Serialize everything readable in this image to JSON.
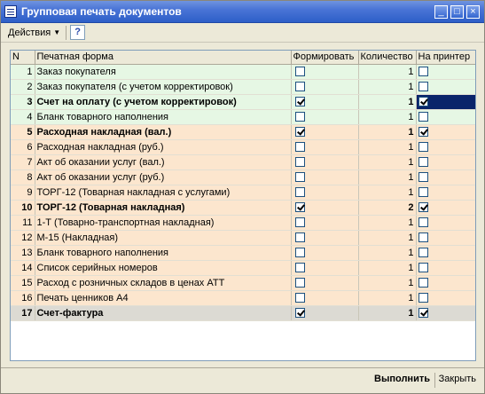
{
  "window": {
    "title": "Групповая печать документов"
  },
  "toolbar": {
    "actions_label": "Действия",
    "help_label": "?"
  },
  "titlebar_buttons": {
    "minimize": "_",
    "maximize": "□",
    "close": "×"
  },
  "table": {
    "columns": [
      "N",
      "Печатная форма",
      "Формировать",
      "Количество",
      "На принтер"
    ],
    "rows": [
      {
        "n": "1",
        "name": "Заказ покупателя",
        "form": false,
        "qty": "1",
        "printer": false,
        "style": "green",
        "bold": false
      },
      {
        "n": "2",
        "name": "Заказ покупателя (с учетом корректировок)",
        "form": false,
        "qty": "1",
        "printer": false,
        "style": "green",
        "bold": false
      },
      {
        "n": "3",
        "name": "Счет на оплату (с учетом корректировок)",
        "form": true,
        "qty": "1",
        "printer": true,
        "style": "green",
        "bold": true,
        "selected": true
      },
      {
        "n": "4",
        "name": "Бланк товарного наполнения",
        "form": false,
        "qty": "1",
        "printer": false,
        "style": "green",
        "bold": false
      },
      {
        "n": "5",
        "name": "Расходная накладная (вал.)",
        "form": true,
        "qty": "1",
        "printer": true,
        "style": "peach",
        "bold": true
      },
      {
        "n": "6",
        "name": "Расходная накладная (руб.)",
        "form": false,
        "qty": "1",
        "printer": false,
        "style": "peach",
        "bold": false
      },
      {
        "n": "7",
        "name": "Акт об оказании услуг (вал.)",
        "form": false,
        "qty": "1",
        "printer": false,
        "style": "peach",
        "bold": false
      },
      {
        "n": "8",
        "name": "Акт об оказании услуг (руб.)",
        "form": false,
        "qty": "1",
        "printer": false,
        "style": "peach",
        "bold": false
      },
      {
        "n": "9",
        "name": "ТОРГ-12 (Товарная накладная с услугами)",
        "form": false,
        "qty": "1",
        "printer": false,
        "style": "peach",
        "bold": false
      },
      {
        "n": "10",
        "name": "ТОРГ-12 (Товарная накладная)",
        "form": true,
        "qty": "2",
        "printer": true,
        "style": "peach",
        "bold": true
      },
      {
        "n": "11",
        "name": "1-Т (Товарно-транспортная накладная)",
        "form": false,
        "qty": "1",
        "printer": false,
        "style": "peach",
        "bold": false
      },
      {
        "n": "12",
        "name": "М-15 (Накладная)",
        "form": false,
        "qty": "1",
        "printer": false,
        "style": "peach",
        "bold": false
      },
      {
        "n": "13",
        "name": "Бланк товарного наполнения",
        "form": false,
        "qty": "1",
        "printer": false,
        "style": "peach",
        "bold": false
      },
      {
        "n": "14",
        "name": "Список серийных номеров",
        "form": false,
        "qty": "1",
        "printer": false,
        "style": "peach",
        "bold": false
      },
      {
        "n": "15",
        "name": "Расход с розничных складов в ценах АТТ",
        "form": false,
        "qty": "1",
        "printer": false,
        "style": "peach",
        "bold": false
      },
      {
        "n": "16",
        "name": "Печать ценников А4",
        "form": false,
        "qty": "1",
        "printer": false,
        "style": "peach",
        "bold": false
      },
      {
        "n": "17",
        "name": "Счет-фактура",
        "form": true,
        "qty": "1",
        "printer": true,
        "style": "gray",
        "bold": true
      }
    ]
  },
  "footer": {
    "run_label": "Выполнить",
    "close_label": "Закрыть"
  },
  "colors": {
    "title_bar": "#2D5FC8",
    "green_row": "#E6F7E4",
    "peach_row": "#FCE6CE",
    "gray_row": "#DCDAD3",
    "selection": "#0A246A"
  }
}
